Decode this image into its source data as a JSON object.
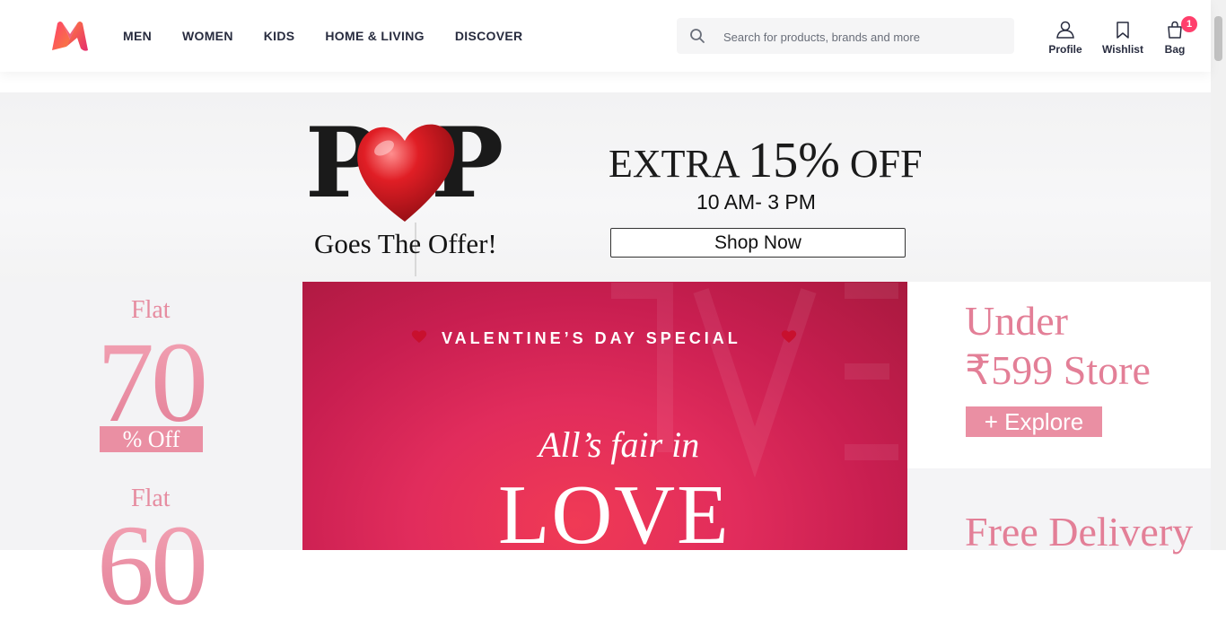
{
  "header": {
    "logo_alt": "Myntra",
    "nav": [
      {
        "label": "MEN"
      },
      {
        "label": "WOMEN"
      },
      {
        "label": "KIDS"
      },
      {
        "label": "HOME & LIVING"
      },
      {
        "label": "DISCOVER"
      }
    ],
    "search": {
      "placeholder": "Search for products, brands and more",
      "icon": "search-icon"
    },
    "actions": {
      "profile": {
        "label": "Profile",
        "icon": "profile-icon"
      },
      "wishlist": {
        "label": "Wishlist",
        "icon": "bookmark-icon"
      },
      "bag": {
        "label": "Bag",
        "icon": "bag-icon",
        "count": "1"
      }
    }
  },
  "banner": {
    "pop_left": "P",
    "pop_right": "P",
    "tagline": "Goes The Offer!",
    "offer_prefix": "EXTRA",
    "offer_percent": "15%",
    "offer_suffix": "OFF",
    "time": "10 AM- 3 PM",
    "cta": "Shop Now"
  },
  "left_offers": [
    {
      "flat": "Flat",
      "value": "70",
      "off": "% Off"
    },
    {
      "flat": "Flat",
      "value": "60"
    }
  ],
  "valentine": {
    "title": "VALENTINE’S DAY SPECIAL",
    "line1": "All’s fair in",
    "line2": "LOVE"
  },
  "right_offers": {
    "under_line1": "Under",
    "under_line2": "₹599 Store",
    "explore": "+ Explore",
    "free": "Free Delivery"
  },
  "colors": {
    "brand_pink": "#ff3f6c",
    "offer_pink": "#e37f97",
    "valentine_red": "#e12c5c",
    "text_dark": "#282c3f"
  }
}
